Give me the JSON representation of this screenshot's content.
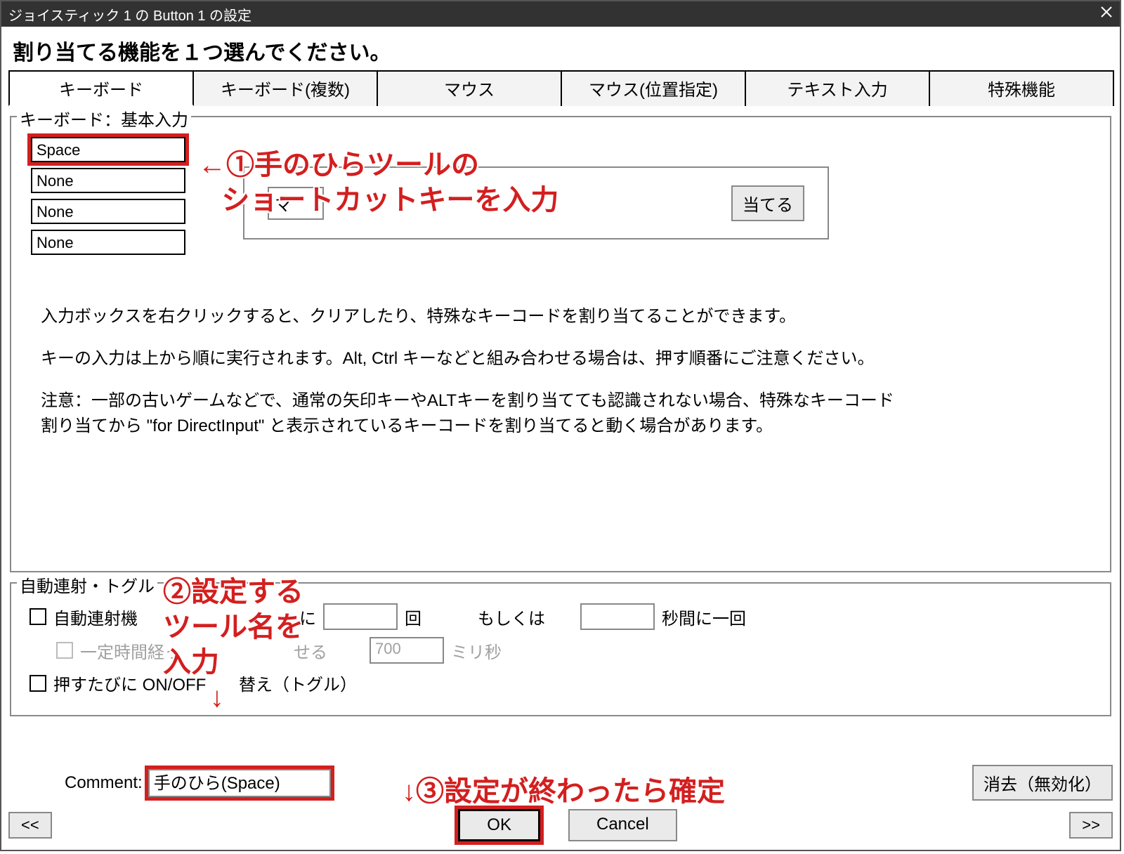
{
  "titlebar": {
    "title": "ジョイスティック 1 の Button 1 の設定"
  },
  "heading": "割り当てる機能を１つ選んでください。",
  "tabs": [
    {
      "label": "キーボード",
      "active": true
    },
    {
      "label": "キーボード(複数)",
      "active": false
    },
    {
      "label": "マウス",
      "active": false
    },
    {
      "label": "マウス(位置指定)",
      "active": false
    },
    {
      "label": "テキスト入力",
      "active": false
    },
    {
      "label": "特殊機能",
      "active": false
    }
  ],
  "group_basic": {
    "legend": "キーボード：基本入力",
    "inputs": [
      "Space",
      "None",
      "None",
      "None"
    ],
    "assign_left": "マ",
    "assign_right": "当てる",
    "help1": "入力ボックスを右クリックすると、クリアしたり、特殊なキーコードを割り当てることができます。",
    "help2": "キーの入力は上から順に実行されます。Alt, Ctrl キーなどと組み合わせる場合は、押す順番にご注意ください。",
    "help3a": "注意：一部の古いゲームなどで、通常の矢印キーやALTキーを割り当てても認識されない場合、特殊なキーコード",
    "help3b": "割り当てから \"for DirectInput\" と表示されているキーコードを割り当てると動く場合があります。"
  },
  "group_auto": {
    "legend": "自動連射・トグル",
    "row1_main": "自動連射機",
    "row1_tail": "に",
    "row1_unit1": "回",
    "row1_or": "もしくは",
    "row1_unit2": "秒間に一回",
    "row2_main": "一定時間経っ",
    "row2_tail": "せる",
    "row2_value": "700",
    "row2_unit": "ミリ秒",
    "row3": "押すたびに ON/OFF       替え（トグル）"
  },
  "comment": {
    "label": "Comment:",
    "value": "手のひら(Space)",
    "clear": "消去（無効化）"
  },
  "buttons": {
    "prev": "<<",
    "ok": "OK",
    "cancel": "Cancel",
    "next": ">>"
  },
  "annotations": {
    "a1_line1": "←①手のひらツールの",
    "a1_line2": "ショートカットキーを入力",
    "a2_line1": "②設定する",
    "a2_line2": "ツール名を",
    "a2_line3": "入力",
    "a2_arrow": "↓",
    "a3": "↓③設定が終わったら確定"
  }
}
